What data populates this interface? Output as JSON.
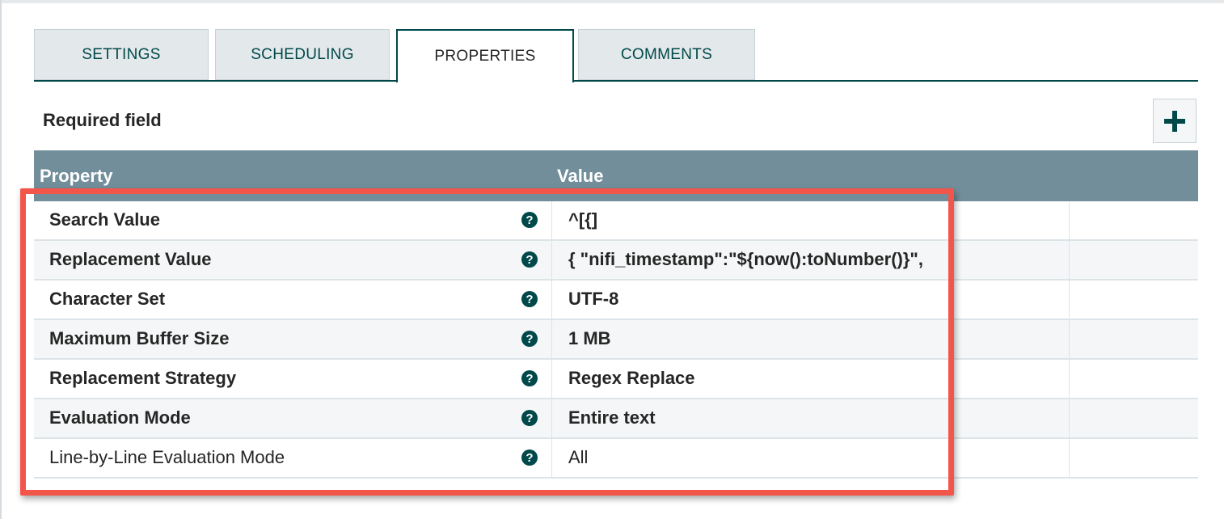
{
  "tabs": [
    {
      "label": "SETTINGS",
      "active": false
    },
    {
      "label": "SCHEDULING",
      "active": false
    },
    {
      "label": "PROPERTIES",
      "active": true
    },
    {
      "label": "COMMENTS",
      "active": false
    }
  ],
  "required_field_label": "Required field",
  "add_button_icon": "plus-icon",
  "table": {
    "headers": {
      "property": "Property",
      "value": "Value"
    },
    "rows": [
      {
        "name": "Search Value",
        "value": "^[{]",
        "required": true
      },
      {
        "name": "Replacement Value",
        "value": "{ \"nifi_timestamp\":\"${now():toNumber()}\",",
        "required": true
      },
      {
        "name": "Character Set",
        "value": "UTF-8",
        "required": true
      },
      {
        "name": "Maximum Buffer Size",
        "value": "1 MB",
        "required": true
      },
      {
        "name": "Replacement Strategy",
        "value": "Regex Replace",
        "required": true
      },
      {
        "name": "Evaluation Mode",
        "value": "Entire text",
        "required": true
      },
      {
        "name": "Line-by-Line Evaluation Mode",
        "value": "All",
        "required": false
      }
    ]
  },
  "colors": {
    "accent": "#004849",
    "table_header": "#728e9b",
    "highlight": "#f2564a"
  }
}
